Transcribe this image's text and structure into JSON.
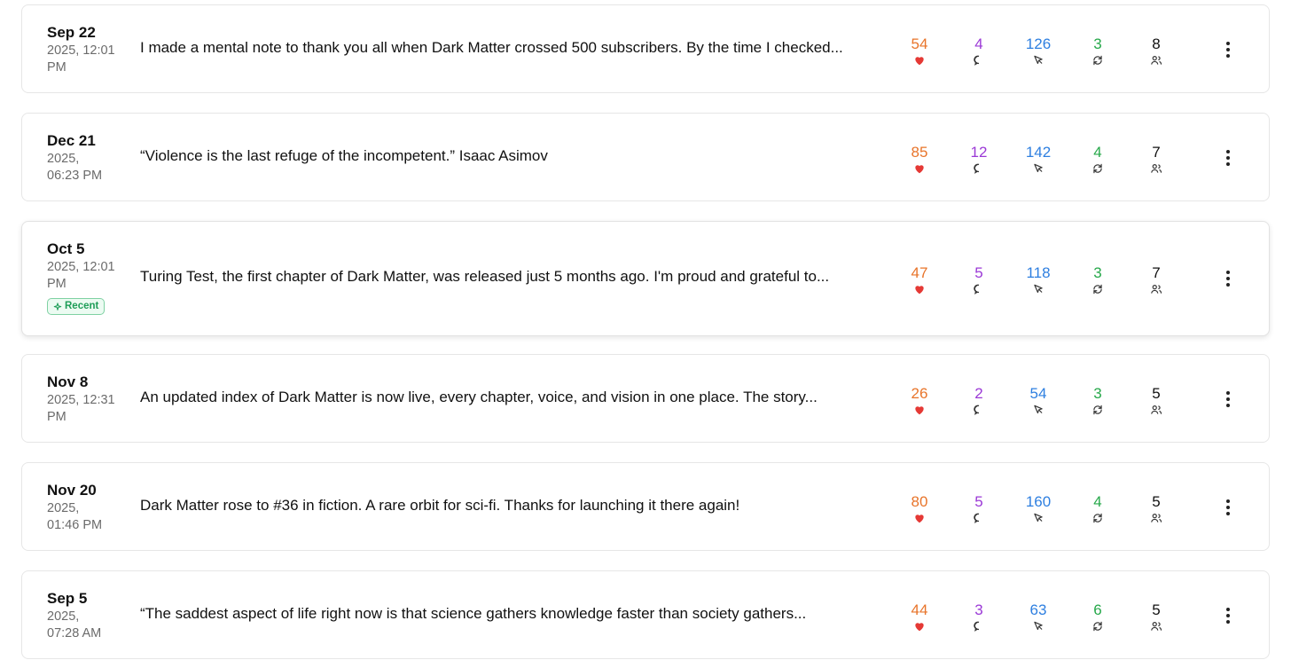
{
  "posts": [
    {
      "date": "Sep 22",
      "time": "2025, 12:01 PM",
      "time_lines": [
        "2025, 12:01",
        "PM"
      ],
      "text": "I made a mental note to thank you all when Dark Matter crossed 500 subscribers. By the time I checked...",
      "likes": "54",
      "comments": "4",
      "clicks": "126",
      "restacks": "3",
      "subscribers": "8",
      "badge": ""
    },
    {
      "date": "Dec 21",
      "time_lines": [
        "2025,",
        "06:23 PM"
      ],
      "text": "“Violence is the last refuge of the incompetent.” Isaac Asimov",
      "likes": "85",
      "comments": "12",
      "clicks": "142",
      "restacks": "4",
      "subscribers": "7",
      "badge": ""
    },
    {
      "date": "Oct 5",
      "time_lines": [
        "2025, 12:01",
        "PM"
      ],
      "text": "Turing Test, the first chapter of Dark Matter, was released just 5 months ago. I'm proud and grateful to...",
      "likes": "47",
      "comments": "5",
      "clicks": "118",
      "restacks": "3",
      "subscribers": "7",
      "badge": "Recent"
    },
    {
      "date": "Nov 8",
      "time_lines": [
        "2025, 12:31",
        "PM"
      ],
      "text": "An updated index of Dark Matter is now live, every chapter, voice, and vision in one place. The story...",
      "likes": "26",
      "comments": "2",
      "clicks": "54",
      "restacks": "3",
      "subscribers": "5",
      "badge": ""
    },
    {
      "date": "Nov 20",
      "time_lines": [
        "2025,",
        "01:46 PM"
      ],
      "text": "Dark Matter rose to #36 in fiction. A rare orbit for sci-fi. Thanks for launching it there again!",
      "likes": "80",
      "comments": "5",
      "clicks": "160",
      "restacks": "4",
      "subscribers": "5",
      "badge": ""
    },
    {
      "date": "Sep 5",
      "time_lines": [
        "2025,",
        "07:28 AM"
      ],
      "text": "“The saddest aspect of life right now is that science gathers knowledge faster than society gathers...",
      "likes": "44",
      "comments": "3",
      "clicks": "63",
      "restacks": "6",
      "subscribers": "5",
      "badge": ""
    }
  ],
  "colors": {
    "likes": "#e8742a",
    "heart": "#e53935",
    "comments": "#9b39d6",
    "clicks": "#2e7fe0",
    "restacks": "#26a84a",
    "badge": "#1e9e58"
  },
  "icons": {
    "likes": "heart-icon",
    "comments": "comment-bubble-icon",
    "clicks": "cursor-click-icon",
    "restacks": "restack-arrows-icon",
    "subscribers": "users-icon",
    "badge": "sparkle-icon",
    "menu": "more-vertical-icon"
  }
}
